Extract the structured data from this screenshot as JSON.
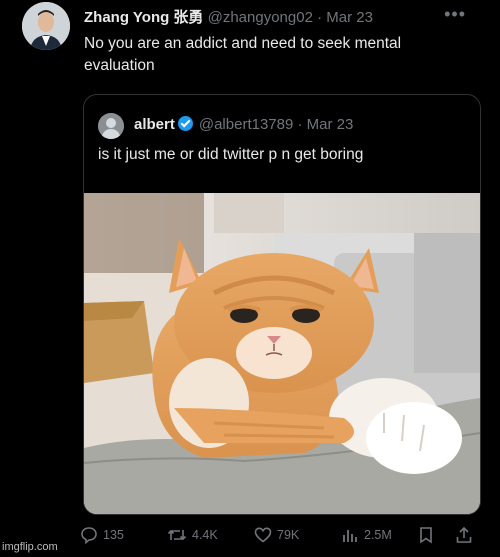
{
  "tweet": {
    "author_name": "Zhang Yong 张勇",
    "author_handle": "@zhangyong02",
    "timestamp": "Mar 23",
    "text": "No you are an addict and need to seek mental evaluation",
    "more_icon": "more-horizontal-icon"
  },
  "quoted": {
    "author_name": "albert",
    "author_handle": "@albert13789",
    "timestamp": "Mar 23",
    "text": "is it just me or did twitter p    n get boring",
    "image_description_icon": "sad-cat-photo"
  },
  "actions": {
    "replies": "135",
    "retweets": "4.4K",
    "likes": "79K",
    "views": "2.5M"
  },
  "watermark": "imgflip.com",
  "colors": {
    "background": "#000000",
    "text": "#e7e9ea",
    "muted": "#71767b",
    "verified": "#1d9bf0",
    "border": "#2f3336"
  }
}
